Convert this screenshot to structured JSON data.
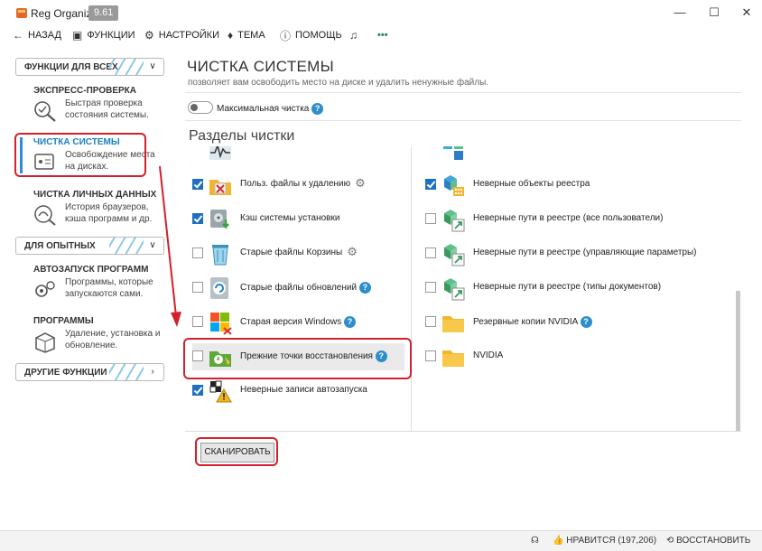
{
  "window": {
    "title": "Reg Organizer",
    "version": "9.61",
    "minimize": "—",
    "maximize": "☐",
    "close": "✕"
  },
  "toolbar": {
    "back": "НАЗАД",
    "functions": "ФУНКЦИИ",
    "settings": "НАСТРОЙКИ",
    "theme": "ТЕМА",
    "help": "ПОМОЩЬ",
    "more": "•••"
  },
  "sidebar": {
    "group_all": "ФУНКЦИИ ДЛЯ ВСЕХ",
    "group_experts": "ДЛЯ ОПЫТНЫХ",
    "group_other": "ДРУГИЕ ФУНКЦИИ",
    "items": [
      {
        "title": "ЭКСПРЕСС-ПРОВЕРКА",
        "desc": "Быстрая проверка состояния системы."
      },
      {
        "title": "ЧИСТКА СИСТЕМЫ",
        "desc": "Освобождение места на дисках."
      },
      {
        "title": "ЧИСТКА ЛИЧНЫХ ДАННЫХ",
        "desc": "История браузеров, кэша программ и др."
      },
      {
        "title": "АВТОЗАПУСК ПРОГРАММ",
        "desc": "Программы, которые запускаются сами."
      },
      {
        "title": "ПРОГРАММЫ",
        "desc": "Удаление, установка и обновление."
      }
    ]
  },
  "main": {
    "title": "ЧИСТКА СИСТЕМЫ",
    "subtitle": "позволяет вам освободить место на диске и удалить ненужные файлы.",
    "toggle_label": "Максимальная чистка",
    "section_title": "Разделы чистки",
    "help_glyph": "?",
    "gear_glyph": "⚙",
    "left_items": [
      {
        "label": "Польз. файлы к удалению",
        "checked": true,
        "gear": true,
        "help": false
      },
      {
        "label": "Кэш системы установки",
        "checked": true,
        "gear": false,
        "help": false
      },
      {
        "label": "Старые файлы Корзины",
        "checked": false,
        "gear": true,
        "help": false
      },
      {
        "label": "Старые файлы обновлений",
        "checked": false,
        "gear": false,
        "help": true
      },
      {
        "label": "Старая версия Windows",
        "checked": false,
        "gear": false,
        "help": true
      },
      {
        "label": "Прежние точки восстановления",
        "checked": false,
        "gear": false,
        "help": true
      },
      {
        "label": "Неверные записи автозапуска",
        "checked": true,
        "gear": false,
        "help": false
      }
    ],
    "right_items": [
      {
        "label": "Неверные объекты реестра",
        "checked": true,
        "help": false
      },
      {
        "label": "Неверные пути в реестре (все пользователи)",
        "checked": false,
        "help": false
      },
      {
        "label": "Неверные пути в реестре (управляющие параметры)",
        "checked": false,
        "help": false
      },
      {
        "label": "Неверные пути в реестре (типы документов)",
        "checked": false,
        "help": false
      },
      {
        "label": "Резервные копии NVIDIA",
        "checked": false,
        "help": true
      },
      {
        "label": "NVIDIA",
        "checked": false,
        "help": false
      }
    ],
    "scan_button": "СКАНИРОВАТЬ"
  },
  "statusbar": {
    "like": "НРАВИТСЯ (197,206)",
    "restore": "ВОССТАНОВИТЬ"
  },
  "colors": {
    "accent": "#2c8fd1",
    "highlight": "#d3202b",
    "checkbox": "#1f6fc1"
  }
}
